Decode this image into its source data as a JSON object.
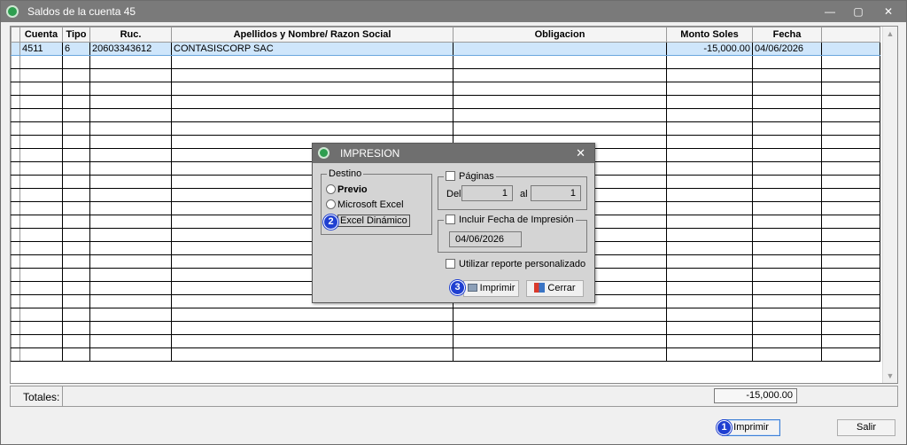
{
  "window": {
    "title": "Saldos de la cuenta 45",
    "controls": [
      "—",
      "▢",
      "✕"
    ]
  },
  "grid": {
    "columns": [
      "Cuenta",
      "Tipo",
      "Ruc.",
      "Apellidos y Nombre/ Razon Social",
      "Obligacion",
      "Monto Soles",
      "Fecha",
      ""
    ],
    "rows": [
      [
        "4511",
        "6",
        "20603343612",
        "CONTASISCORP SAC",
        "",
        "-15,000.00",
        "04/06/2026",
        ""
      ]
    ]
  },
  "totals": {
    "label": "Totales:",
    "value": "-15,000.00"
  },
  "footer": {
    "print_label": "Imprimir",
    "exit_label": "Salir",
    "badge1": "1"
  },
  "dialog": {
    "title": "IMPRESION",
    "close": "✕",
    "destino": {
      "legend": "Destino",
      "options": [
        "Previo",
        "Microsoft Excel",
        "Excel Dinámico"
      ],
      "badge2": "2"
    },
    "paginas": {
      "legend": "Páginas",
      "del_label": "Del",
      "del_value": "1",
      "al_label": "al",
      "al_value": "1"
    },
    "fecha": {
      "legend": "Incluir Fecha de Impresión",
      "value": "04/06/2026"
    },
    "personalizado_label": "Utilizar reporte personalizado",
    "print_label": "Imprimir",
    "close_label": "Cerrar",
    "badge3": "3"
  },
  "colors": {
    "selection": "#cfe6fb",
    "badge": "#1f3fd1",
    "titlebar": "#7a7a7a"
  },
  "icons": [
    "app-logo-icon",
    "minimize-icon",
    "maximize-icon",
    "close-icon",
    "printer-icon",
    "exit-door-icon",
    "scroll-up-icon",
    "scroll-down-icon"
  ]
}
